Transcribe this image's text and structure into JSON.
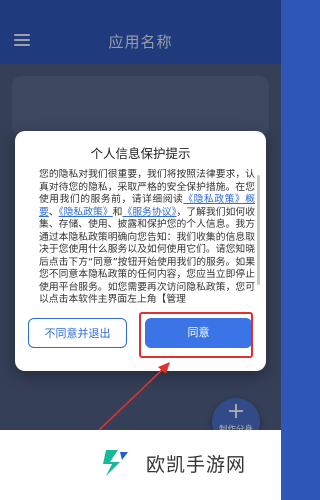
{
  "app": {
    "title": "应用名称",
    "fab_label": "制作分身",
    "fab_symbol": "+"
  },
  "dialog": {
    "title": "个人信息保护提示",
    "body": [
      {
        "text": "您的隐私对我们很重要，我们将按照法律要求，认真对待您的隐私，采取严格的安全保护措施。在您使用我们的服务前，请详细阅读"
      },
      {
        "text": "《隐私政策》概要",
        "link": true
      },
      {
        "text": "、"
      },
      {
        "text": "《隐私政策》",
        "link": true
      },
      {
        "text": "和"
      },
      {
        "text": "《服务协议》",
        "link": true
      },
      {
        "text": "，了解我们如何收集、存储、使用、披露和保护您的个人信息。我方通过本隐私政策明确向您告知：我们收集的信息取决于您使用什么服务以及如何使用它们。请您知晓后点击下方“同意”按钮开始使用我们的服务。如果您不同意本隐私政策的任何内容，您应当立即停止使用平台服务。如您需要再次访问隐私政策，您可以点击本软件主界面左上角【管理"
      }
    ],
    "decline_label": "不同意并退出",
    "agree_label": "同意"
  },
  "watermark": {
    "text": "欧凯手游网"
  },
  "colors": {
    "header": "#2f57b8",
    "link": "#2f6bd6",
    "primary_button": "#3a74e6",
    "highlight": "#e03030",
    "watermark_logo": "#18b89a"
  }
}
